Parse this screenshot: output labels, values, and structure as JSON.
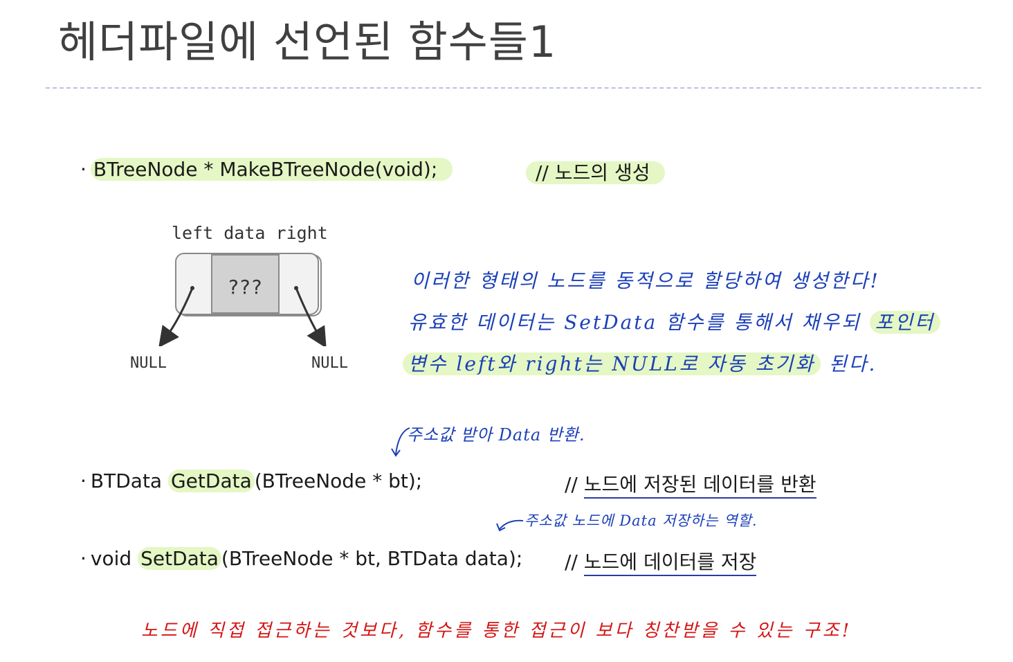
{
  "title": "헤더파일에 선언된 함수들1",
  "bullets": {
    "make": {
      "dot": "·",
      "code": "BTreeNode * MakeBTreeNode(void);",
      "comment": "// 노드의 생성"
    },
    "get": {
      "dot": "·",
      "prefix": "BTData ",
      "fn": "GetData",
      "rest": "(BTreeNode * bt);",
      "comment_prefix": "// ",
      "comment": "노드에 저장된 데이터를 반환"
    },
    "set": {
      "dot": "·",
      "prefix": "void ",
      "fn": "SetData",
      "rest": "(BTreeNode * bt, BTData data);",
      "comment_prefix": "// ",
      "comment": "노드에 데이터를 저장"
    }
  },
  "diagram": {
    "labels": "left data right",
    "center": "???",
    "null_left": "NULL",
    "null_right": "NULL"
  },
  "handwriting": {
    "line1": "이러한 형태의 노드를 동적으로 할당하여 생성한다!",
    "line2_a": "유효한 데이터는 SetData 함수를 통해서 채우되",
    "line2_b": "포인터",
    "line3_a": "변수 left와 right는 NULL로 자동 초기화",
    "line3_b": "된다.",
    "note_get": "주소값 받아 Data 반환.",
    "note_set": "주소값 노드에 Data 저장하는 역할."
  },
  "footer": "노드에 직접 접근하는 것보다, 함수를 통한 접근이 보다 칭찬받을 수 있는 구조!",
  "colors": {
    "highlight": "#e4f7c4",
    "handwriting": "#1a3fb8",
    "red": "#d41515"
  }
}
